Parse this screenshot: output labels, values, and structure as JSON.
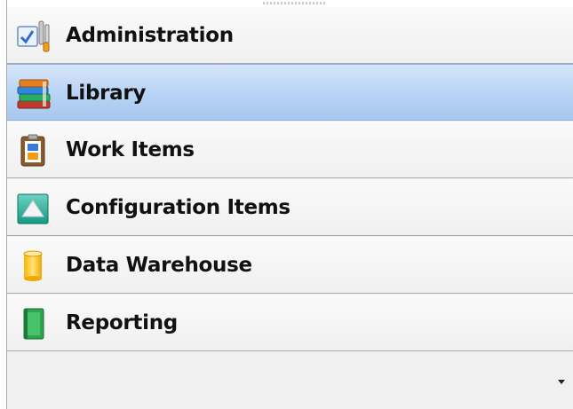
{
  "nav": {
    "selected_index": 1,
    "items": [
      {
        "label": "Administration",
        "icon": "administration-icon"
      },
      {
        "label": "Library",
        "icon": "library-books-icon"
      },
      {
        "label": "Work Items",
        "icon": "work-items-clipboard-icon"
      },
      {
        "label": "Configuration Items",
        "icon": "configuration-items-icon"
      },
      {
        "label": "Data Warehouse",
        "icon": "data-warehouse-cylinder-icon"
      },
      {
        "label": "Reporting",
        "icon": "reporting-book-icon"
      }
    ]
  },
  "footer": {
    "overflow_icon": "overflow-dropdown-icon"
  },
  "colors": {
    "selected_bg": "#b9d4f4",
    "selected_border": "#8db2e3",
    "item_bg": "#f4f4f4",
    "divider": "#a9a9a9",
    "text": "#111111"
  }
}
